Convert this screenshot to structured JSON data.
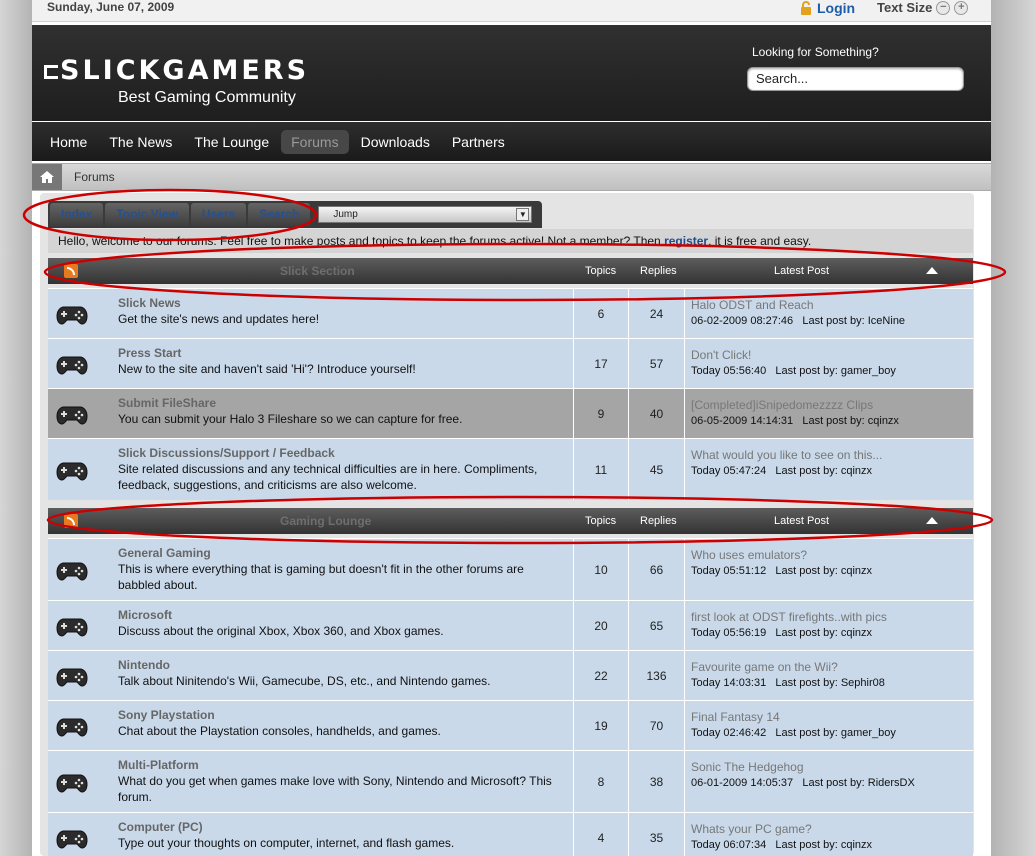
{
  "topbar": {
    "date": "Sunday, June 07, 2009",
    "login": "Login",
    "text_size": "Text Size",
    "minus": "−",
    "plus": "+"
  },
  "header": {
    "logo": "SLICKGAMERS",
    "slogan": "Best Gaming Community",
    "search_label": "Looking for Something?",
    "search_value": "Search..."
  },
  "nav": [
    "Home",
    "The News",
    "The Lounge",
    "Forums",
    "Downloads",
    "Partners"
  ],
  "breadcrumb": "Forums",
  "tabs": [
    "Index",
    "Topic View",
    "Users",
    "Search"
  ],
  "jump": "Jump",
  "welcome": {
    "text": "Hello, welcome to our forums. Feel free to make posts and topics to keep the forums active! Not a member? Then ",
    "link": "register",
    "tail": ", it is free and easy."
  },
  "columns": {
    "topics": "Topics",
    "replies": "Replies",
    "latest": "Latest Post"
  },
  "sections": [
    {
      "title": "Slick Section",
      "forums": [
        {
          "name": "Slick News",
          "desc": "Get the site's news and updates here!",
          "topics": "6",
          "replies": "24",
          "last_title": "Halo ODST and Reach",
          "last_date": "06-02-2009 08:27:46",
          "last_by": "Last post by: IceNine"
        },
        {
          "name": "Press Start",
          "desc": "New to the site and haven't said 'Hi'? Introduce yourself!",
          "topics": "17",
          "replies": "57",
          "last_title": "Don't Click!",
          "last_date": "Today 05:56:40",
          "last_by": "Last post by: gamer_boy"
        },
        {
          "name": "Submit FileShare",
          "desc": "You can submit your Halo 3 Fileshare so we can capture for free.",
          "topics": "9",
          "replies": "40",
          "last_title": "[Completed]iSnipedomezzzz Clips",
          "last_date": "06-05-2009 14:14:31",
          "last_by": "Last post by: cqinzx"
        },
        {
          "name": "Slick Discussions/Support / Feedback",
          "desc": "Site related discussions and any technical difficulties are in here. Compliments, feedback, suggestions, and criticisms are also welcome.",
          "topics": "11",
          "replies": "45",
          "last_title": "What would you like to see on this...",
          "last_date": "Today 05:47:24",
          "last_by": "Last post by: cqinzx"
        }
      ]
    },
    {
      "title": "Gaming Lounge",
      "forums": [
        {
          "name": "General Gaming",
          "desc": "This is where everything that is gaming but doesn't fit in the other forums are babbled about.",
          "topics": "10",
          "replies": "66",
          "last_title": "Who uses emulators?",
          "last_date": "Today 05:51:12",
          "last_by": "Last post by: cqinzx"
        },
        {
          "name": "Microsoft",
          "desc": "Discuss about the original Xbox, Xbox 360, and Xbox games.",
          "topics": "20",
          "replies": "65",
          "last_title": "first look at ODST firefights..with pics",
          "last_date": "Today 05:56:19",
          "last_by": "Last post by: cqinzx"
        },
        {
          "name": "Nintendo",
          "desc": "Talk about Ninitendo's Wii, Gamecube, DS, etc., and Nintendo games.",
          "topics": "22",
          "replies": "136",
          "last_title": "Favourite game on the Wii?",
          "last_date": "Today 14:03:31",
          "last_by": "Last post by: Sephir08"
        },
        {
          "name": "Sony Playstation",
          "desc": "Chat about the Playstation consoles, handhelds, and games.",
          "topics": "19",
          "replies": "70",
          "last_title": "Final Fantasy 14",
          "last_date": "Today 02:46:42",
          "last_by": "Last post by: gamer_boy"
        },
        {
          "name": "Multi-Platform",
          "desc": "What do you get when games make love with Sony, Nintendo and Microsoft? This forum.",
          "topics": "8",
          "replies": "38",
          "last_title": "Sonic The Hedgehog",
          "last_date": "06-01-2009 14:05:37",
          "last_by": "Last post by: RidersDX"
        },
        {
          "name": "Computer (PC)",
          "desc": "Type out your thoughts on computer, internet, and flash games.",
          "topics": "4",
          "replies": "35",
          "last_title": "Whats your PC game?",
          "last_date": "Today 06:07:34",
          "last_by": "Last post by: cqinzx"
        }
      ]
    }
  ],
  "colors": {
    "row": "#c9d9ea",
    "highlight_row": "#a5a5a5",
    "annotation": "#cc0000",
    "link": "#1d5da8"
  }
}
